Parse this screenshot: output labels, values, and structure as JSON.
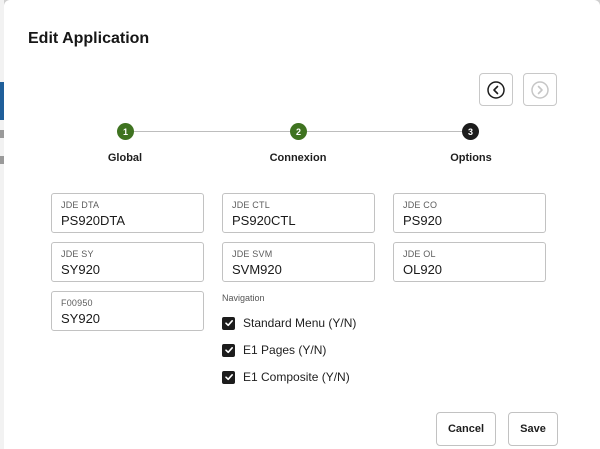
{
  "dialog": {
    "title": "Edit Application"
  },
  "nav": {
    "prev_icon": "chevron-left-circle-icon",
    "next_icon": "chevron-right-circle-icon"
  },
  "steps": [
    {
      "number": "1",
      "label": "Global",
      "state": "done"
    },
    {
      "number": "2",
      "label": "Connexion",
      "state": "done"
    },
    {
      "number": "3",
      "label": "Options",
      "state": "current"
    }
  ],
  "fields": {
    "jde_dta": {
      "label": "JDE DTA",
      "value": "PS920DTA"
    },
    "jde_ctl": {
      "label": "JDE CTL",
      "value": "PS920CTL"
    },
    "jde_co": {
      "label": "JDE CO",
      "value": "PS920"
    },
    "jde_sy": {
      "label": "JDE SY",
      "value": "SY920"
    },
    "jde_svm": {
      "label": "JDE SVM",
      "value": "SVM920"
    },
    "jde_ol": {
      "label": "JDE OL",
      "value": "OL920"
    },
    "f00950": {
      "label": "F00950",
      "value": "SY920"
    }
  },
  "navigation": {
    "heading": "Navigation",
    "options": [
      {
        "label": "Standard Menu (Y/N)",
        "checked": true
      },
      {
        "label": "E1 Pages (Y/N)",
        "checked": true
      },
      {
        "label": "E1 Composite (Y/N)",
        "checked": true
      }
    ]
  },
  "buttons": {
    "cancel": "Cancel",
    "save": "Save"
  },
  "colors": {
    "step_done": "#3f7320",
    "step_current": "#1c1c1c",
    "checkbox": "#1c1c1c"
  }
}
